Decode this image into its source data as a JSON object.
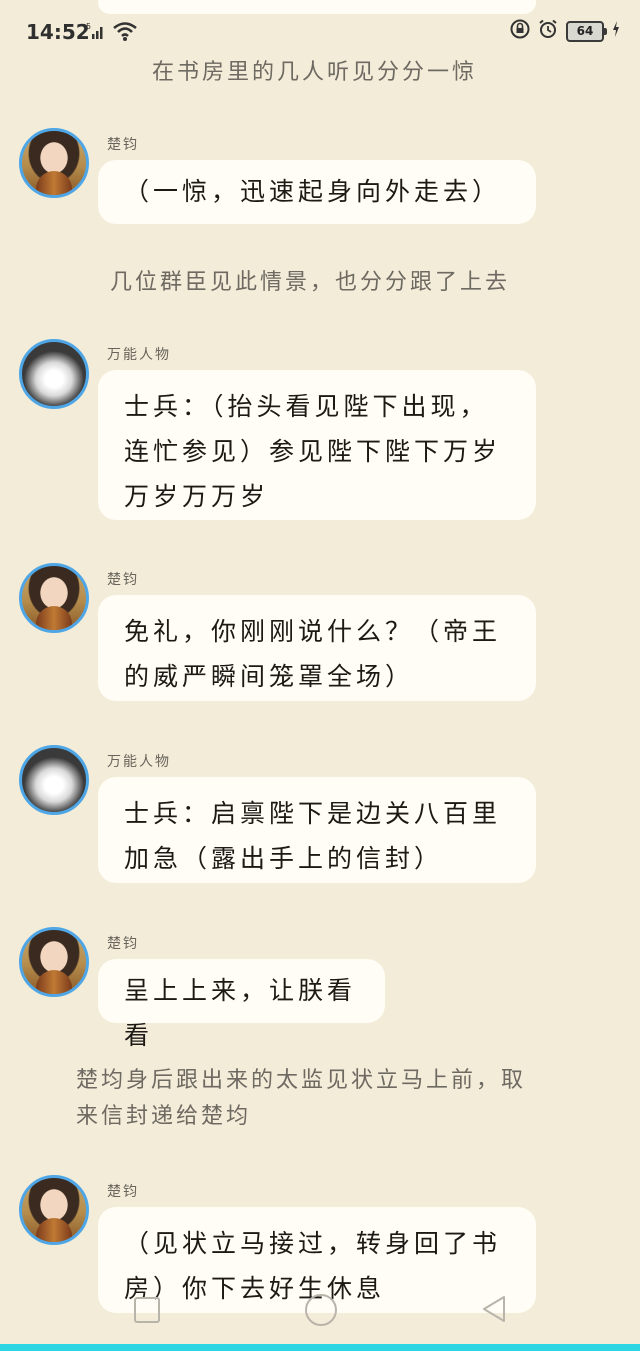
{
  "status_bar": {
    "time": "14:52",
    "signal_label": "5G",
    "battery": "64",
    "icons": [
      "signal-icon",
      "wifi-icon",
      "lock-icon",
      "alarm-icon",
      "battery-icon",
      "charging-icon"
    ]
  },
  "chat": [
    {
      "type": "narration",
      "text": "在书房里的几人听见分分一惊"
    },
    {
      "type": "message",
      "sender": "楚钧",
      "avatar": "king",
      "lines": [
        "（一惊，迅速起身向外走去）"
      ]
    },
    {
      "type": "narration",
      "text": "几位群臣见此情景，也分分跟了上去"
    },
    {
      "type": "message",
      "sender": "万能人物",
      "avatar": "extra",
      "lines": [
        "士兵：（抬头看见陛下出现，",
        "连忙参见）参见陛下陛下万岁",
        "万岁万万岁"
      ]
    },
    {
      "type": "message",
      "sender": "楚钧",
      "avatar": "king",
      "lines": [
        "免礼，你刚刚说什么？（帝王",
        "的威严瞬间笼罩全场）"
      ]
    },
    {
      "type": "message",
      "sender": "万能人物",
      "avatar": "extra",
      "lines": [
        "士兵：启禀陛下是边关八百里",
        "加急（露出手上的信封）"
      ]
    },
    {
      "type": "message",
      "sender": "楚钧",
      "avatar": "king",
      "lines": [
        "呈上上来，让朕看看"
      ]
    },
    {
      "type": "narration",
      "lines": [
        "楚均身后跟出来的太监见状立马上前，取",
        "来信封递给楚均"
      ]
    },
    {
      "type": "message",
      "sender": "楚钧",
      "avatar": "king",
      "lines": [
        "（见状立马接过，转身回了书",
        "房）你下去好生休息"
      ]
    }
  ],
  "colors": {
    "background": "#f3ecd9",
    "bubble": "#fffdf6",
    "avatar_ring": "#4ea6e6",
    "accent_strip": "#2dd6e3"
  }
}
